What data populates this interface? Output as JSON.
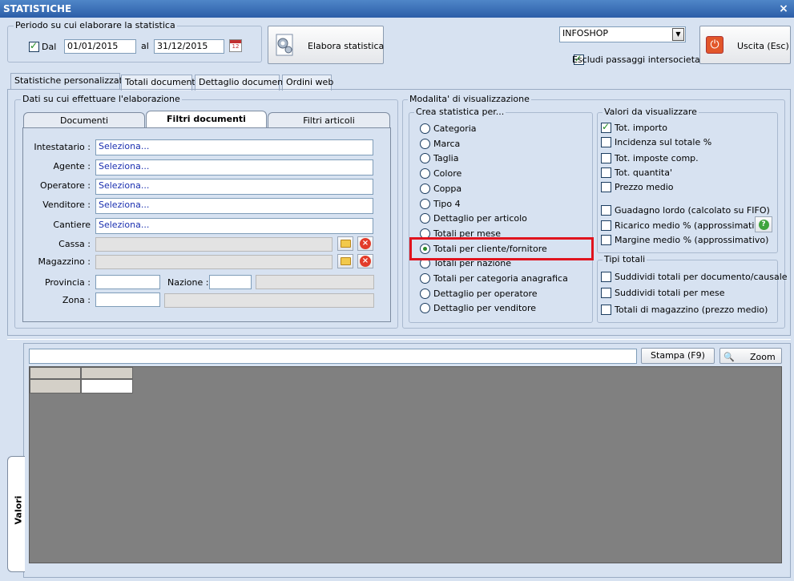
{
  "window": {
    "title": "STATISTICHE",
    "close": "×"
  },
  "period": {
    "legend": "Periodo su cui elaborare la statistica",
    "dal_label": "Dal",
    "dal_checked": true,
    "date_from": "01/01/2015",
    "al_label": "al",
    "date_to": "31/12/2015"
  },
  "process_button": "Elabora statistica",
  "company_select": "INFOSHOP",
  "exclude_check": {
    "label": "Escludi passaggi intersocietari",
    "checked": true
  },
  "exit_button": "Uscita (Esc)",
  "main_tabs": [
    "Statistiche personalizzate",
    "Totali documenti",
    "Dettaglio documenti",
    "Ordini web"
  ],
  "filters": {
    "legend": "Dati su cui effettuare l'elaborazione",
    "subtabs": [
      "Documenti",
      "Filtri documenti",
      "Filtri articoli"
    ],
    "fields": [
      {
        "label": "Intestatario :",
        "value": "Seleziona..."
      },
      {
        "label": "Agente :",
        "value": "Seleziona..."
      },
      {
        "label": "Operatore :",
        "value": "Seleziona..."
      },
      {
        "label": "Venditore :",
        "value": "Seleziona..."
      },
      {
        "label": "Cantiere",
        "value": "Seleziona..."
      }
    ],
    "cassa_label": "Cassa :",
    "magazzino_label": "Magazzino :",
    "provincia_label": "Provincia :",
    "nazione_label": "Nazione :",
    "zona_label": "Zona :"
  },
  "view_mode": {
    "legend": "Modalita' di visualizzazione",
    "create_legend": "Crea statistica per...",
    "options": [
      "Categoria",
      "Marca",
      "Taglia",
      "Colore",
      "Coppa",
      "Tipo 4",
      "Dettaglio per articolo",
      "Totali per mese",
      "Totali per cliente/fornitore",
      "Totali per nazione",
      "Totali per categoria anagrafica",
      "Dettaglio per operatore",
      "Dettaglio per venditore"
    ],
    "selected_index": 8,
    "values_legend": "Valori da visualizzare",
    "values": [
      {
        "label": "Tot. importo",
        "checked": true
      },
      {
        "label": "Incidenza sul totale %",
        "checked": false
      },
      {
        "label": "Tot. imposte comp.",
        "checked": false
      },
      {
        "label": "Tot. quantita'",
        "checked": false
      },
      {
        "label": "Prezzo medio",
        "checked": false
      },
      {
        "label": "Guadagno lordo (calcolato su FIFO)",
        "checked": false
      },
      {
        "label": "Ricarico medio % (approssimativo)",
        "checked": false
      },
      {
        "label": "Margine medio % (approssimativo)",
        "checked": false
      }
    ],
    "totals_legend": "Tipi totali",
    "totals": [
      {
        "label": "Suddividi totali per documento/causale",
        "checked": false
      },
      {
        "label": "Suddividi totali per mese",
        "checked": false
      },
      {
        "label": "Totali di magazzino (prezzo medio)",
        "checked": false
      }
    ]
  },
  "bottom": {
    "print_button": "Stampa (F9)",
    "zoom_button": "Zoom",
    "side_tab": "Valori"
  },
  "colors": {
    "highlight": "#e0141e",
    "grid_bg": "#808080"
  }
}
